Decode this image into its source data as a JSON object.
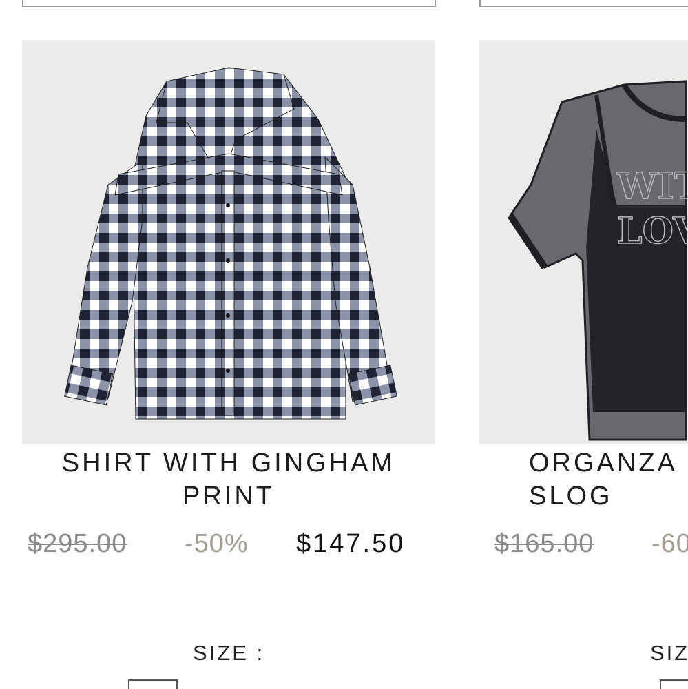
{
  "products": [
    {
      "title": "SHIRT WITH GINGHAM\nPRINT",
      "original_price": "$295.00",
      "discount": "-50%",
      "sale_price": "$147.50",
      "size_label": "SIZE :"
    },
    {
      "title": "ORGANZA\nSLOG",
      "original_price": "$165.00",
      "discount": "-60",
      "sale_price": "",
      "size_label": "SIZ",
      "graphic_text": [
        "WIT",
        "LOV"
      ]
    }
  ],
  "colors": {
    "image_background": "#ebebea",
    "old_price": "#8a8a8a",
    "discount": "#a39d92",
    "sale_price": "#111111"
  }
}
